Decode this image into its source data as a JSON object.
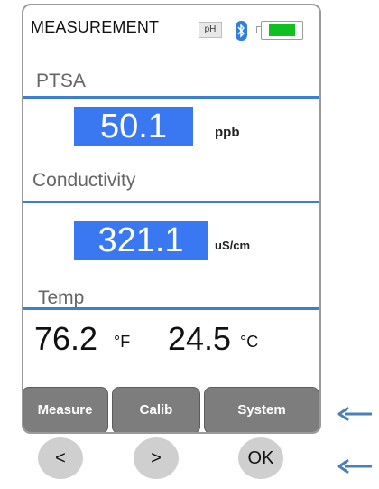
{
  "screen": {
    "title": "MEASUREMENT",
    "ph_badge": "pH",
    "battery_level": 0.85,
    "status_icons": [
      "ph-badge",
      "bluetooth-icon",
      "battery-icon"
    ]
  },
  "ptsa": {
    "label": "PTSA",
    "value": "50.1",
    "unit": "ppb"
  },
  "conductivity": {
    "label": "Conductivity",
    "value": "321.1",
    "unit": "uS/cm"
  },
  "temp": {
    "label": "Temp",
    "fahrenheit_value": "76.2",
    "fahrenheit_unit": "°F",
    "celsius_value": "24.5",
    "celsius_unit": "°C"
  },
  "soft_keys": {
    "measure": "Measure",
    "calib": "Calib",
    "system": "System"
  },
  "hardware_buttons": {
    "left": "<",
    "right": ">",
    "ok": "OK"
  },
  "colors": {
    "value_box": "#3a78f2",
    "section_rule": "#3b7ed4",
    "soft_key": "#7d7d7d",
    "arrow": "#4a7fb8",
    "battery_fill": "#10c020"
  }
}
